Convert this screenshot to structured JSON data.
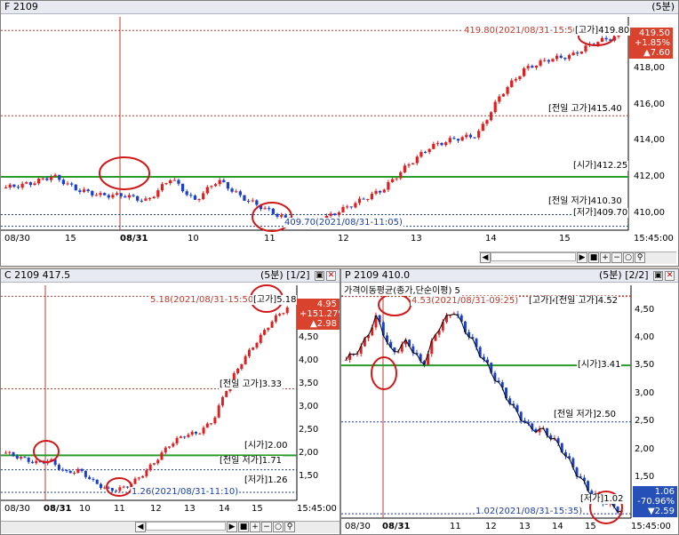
{
  "top": {
    "title": "F 2109",
    "period": "(5분)",
    "badge": [
      "419.50",
      "+1.85%",
      "▲7.60"
    ],
    "hline_labels": {
      "open": "[시가]412.25",
      "prev_high": "[전일 고가]415.40",
      "prev_low": "[전일 저가]410.30",
      "low": "[저가]409.70"
    },
    "high_note": "419.80(2021/08/31-15:50)",
    "high_tag": "[고가]419.80",
    "low_note": "409.70(2021/08/31-11:05)",
    "yticks": [
      "418,00",
      "416,00",
      "414,00",
      "412,00",
      "410,00"
    ],
    "xticks": [
      "08/30",
      "15",
      "08/31",
      "10",
      "11",
      "12",
      "13",
      "14",
      "15",
      "15:45:00"
    ]
  },
  "call": {
    "title": "C 2109 417.5",
    "period": "(5분)",
    "page": "[1/2]",
    "badge": [
      "4.95",
      "+151.27%",
      "▲2.98"
    ],
    "hline_labels": {
      "prev_high": "[전일 고가]3.33",
      "open": "[시가]2.00",
      "prev_low": "[전일 저가]1.71",
      "low": "[저가]1.26"
    },
    "high_note": "5.18(2021/08/31-15:50)",
    "high_tag": "[고가]5.18",
    "low_note": "1.26(2021/08/31-11:10)",
    "yticks": [
      "4,50",
      "4,00",
      "3,50",
      "3,00",
      "2,50",
      "2,00",
      "1,50"
    ],
    "xticks": [
      "08/30",
      "08/31",
      "10",
      "11",
      "12",
      "13",
      "14",
      "15",
      "15:45:00"
    ]
  },
  "put": {
    "title": "P 2109 410.0",
    "period": "(5분)",
    "page": "[2/2]",
    "indicator": "가격이동평균(종가,단순이평) 5",
    "badge": [
      "1.06",
      "-70.96%",
      "▼2.59"
    ],
    "hline_labels": {
      "prev_high": "[전일 고가]4.52",
      "open": "[시가]3.41",
      "prev_low": "[전일 저가]2.50",
      "low": "[저가]1.02"
    },
    "high_note": "4.53(2021/08/31-09:25)",
    "high_tag": "[고가]4.53",
    "low_note": "1.02(2021/08/31-15:35)",
    "yticks": [
      "4,50",
      "4,00",
      "3,50",
      "3,00",
      "2,50",
      "2,00",
      "1,50"
    ],
    "xticks": [
      "08/30",
      "08/31",
      "11",
      "12",
      "13",
      "14",
      "15",
      "15:45:00"
    ]
  },
  "chart_data": [
    {
      "type": "candlestick",
      "title": "F 2109",
      "ylim": [
        409.5,
        420.5
      ],
      "x": [
        "08/30",
        "08/31",
        "10",
        "11",
        "12",
        "13",
        "14",
        "15"
      ],
      "close_path": [
        411.7,
        411.9,
        412.3,
        411.6,
        411.3,
        411.3,
        411.0,
        412.2,
        411.0,
        412.1,
        411.2,
        410.6,
        410.0,
        409.8,
        410.4,
        411.0,
        411.6,
        412.8,
        413.8,
        414.2,
        414.4,
        416.5,
        417.8,
        418.3,
        418.5,
        419.2,
        419.5
      ],
      "hlines": {
        "open": 412.25,
        "prev_high": 415.4,
        "prev_low": 410.3,
        "low": 409.7,
        "high": 419.8
      }
    },
    {
      "type": "candlestick",
      "title": "C 2109 417.5",
      "ylim": [
        1.1,
        5.4
      ],
      "x": [
        "08/30",
        "08/31",
        "10",
        "11",
        "12",
        "13",
        "14",
        "15"
      ],
      "close_path": [
        2.05,
        1.95,
        1.85,
        1.9,
        1.65,
        1.7,
        1.45,
        1.3,
        1.35,
        1.55,
        1.85,
        2.2,
        2.4,
        2.45,
        2.7,
        3.4,
        3.9,
        4.3,
        4.7,
        4.95
      ],
      "hlines": {
        "prev_high": 3.33,
        "open": 2.0,
        "prev_low": 1.71,
        "low": 1.26,
        "high": 5.18
      }
    },
    {
      "type": "candlestick",
      "title": "P 2109 410.0",
      "ylim": [
        0.95,
        4.7
      ],
      "x": [
        "08/30",
        "08/31",
        "11",
        "12",
        "13",
        "14",
        "15"
      ],
      "close_path": [
        3.5,
        3.7,
        4.2,
        3.6,
        3.8,
        3.4,
        4.0,
        4.3,
        3.9,
        3.5,
        3.1,
        2.7,
        2.4,
        2.35,
        2.1,
        1.7,
        1.35,
        1.2,
        1.06
      ],
      "hlines": {
        "prev_high": 4.52,
        "open": 3.41,
        "prev_low": 2.5,
        "low": 1.02,
        "high": 4.53
      }
    }
  ]
}
